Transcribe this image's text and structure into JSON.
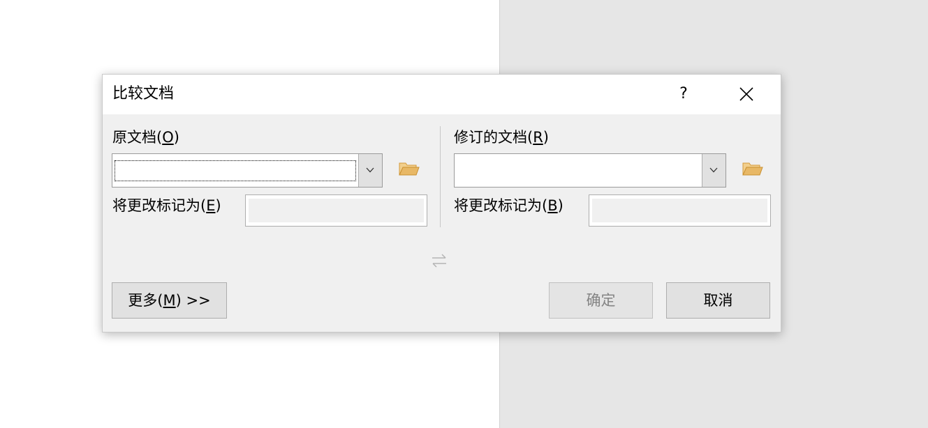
{
  "dialog": {
    "title": "比较文档",
    "help_label": "?"
  },
  "original": {
    "label": "原文档(",
    "label_key": "O",
    "label_end": ")",
    "value": "",
    "mark_label": "将更改标记为(",
    "mark_key": "E",
    "mark_end": ")",
    "mark_value": ""
  },
  "revised": {
    "label": "修订的文档(",
    "label_key": "R",
    "label_end": ")",
    "value": "",
    "mark_label": "将更改标记为(",
    "mark_key": "B",
    "mark_end": ")",
    "mark_value": ""
  },
  "buttons": {
    "more_label": "更多(",
    "more_key": "M",
    "more_end": ") >>",
    "ok_label": "确定",
    "cancel_label": "取消"
  },
  "icons": {
    "help": "question-mark",
    "close": "close-x",
    "dropdown": "chevron-down",
    "browse": "folder-open",
    "swap": "swap-arrows"
  },
  "colors": {
    "dialog_bg": "#f0f0f0",
    "titlebar_bg": "#ffffff",
    "button_bg": "#e1e1e1",
    "folder": "#e8b866"
  }
}
